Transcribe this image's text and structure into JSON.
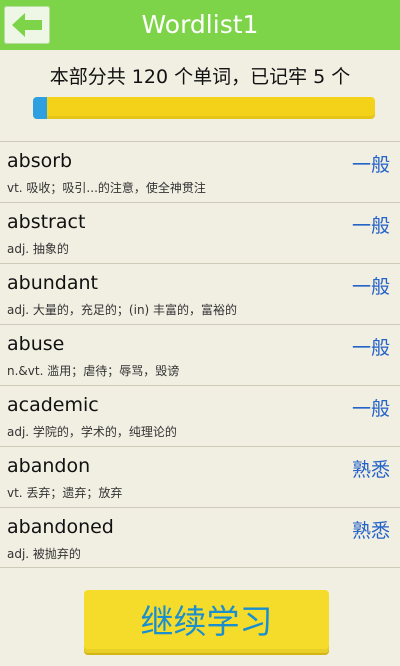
{
  "header": {
    "title": "Wordlist1",
    "back_icon": "arrow-left-icon",
    "color": "#7ed449"
  },
  "summary": {
    "text": "本部分共 120 个单词，已记牢 5 个",
    "total": 120,
    "remembered": 5
  },
  "progress": {
    "value": 0.0417,
    "fill_color": "#2e9fe0",
    "track_color": "#f4d21a"
  },
  "words": [
    {
      "word": "absorb",
      "definition": "vt. 吸收；吸引...的注意，使全神贯注",
      "level": "一般"
    },
    {
      "word": "abstract",
      "definition": "adj. 抽象的",
      "level": "一般"
    },
    {
      "word": "abundant",
      "definition": "adj. 大量的，充足的；(in) 丰富的，富裕的",
      "level": "一般"
    },
    {
      "word": "abuse",
      "definition": "n.&vt. 滥用；虐待；辱骂，毁谤",
      "level": "一般"
    },
    {
      "word": "academic",
      "definition": "adj. 学院的，学术的，纯理论的",
      "level": "一般"
    },
    {
      "word": "abandon",
      "definition": "vt. 丢弃；遗弃；放弃",
      "level": "熟悉"
    },
    {
      "word": "abandoned",
      "definition": "adj. 被抛弃的",
      "level": "熟悉"
    }
  ],
  "footer": {
    "continue_label": "继续学习"
  }
}
